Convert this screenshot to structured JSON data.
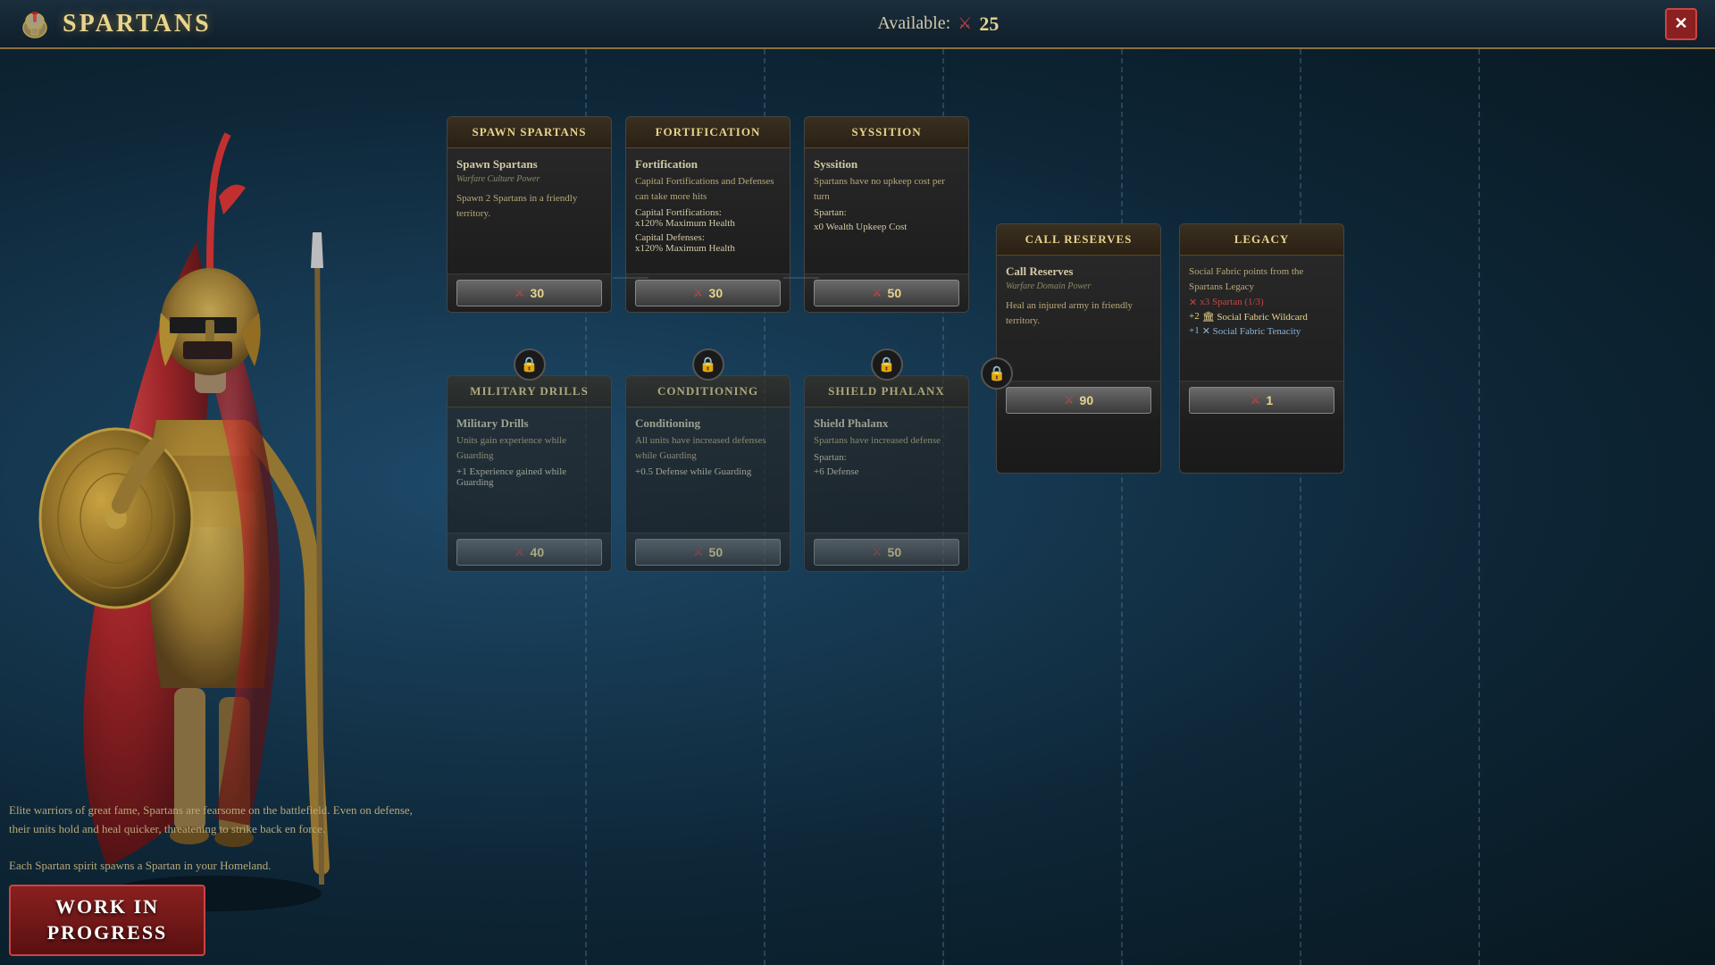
{
  "header": {
    "title": "Spartans",
    "icon": "⛨",
    "available_label": "Available:",
    "available_count": "25",
    "close_label": "✕"
  },
  "warrior": {
    "description": "Elite warriors of great fame, Spartans are fearsome on the battlefield. Even on defense, their units hold and heal quicker, threatening to strike back en force.",
    "description2": "Each Spartan spirit spawns a Spartan in your Homeland."
  },
  "wip": {
    "label": "Work In\nProgress"
  },
  "cards": [
    {
      "id": "spawn-spartans",
      "title": "Spawn Spartans",
      "name": "Spawn Spartans",
      "subtitle": "Warfare Culture Power",
      "description": "Spawn 2 Spartans in a friendly territory.",
      "stats": [],
      "cost": 30,
      "locked": false,
      "row": 0,
      "col": 0
    },
    {
      "id": "military-drills",
      "title": "Military Drills",
      "name": "Military Drills",
      "subtitle": "",
      "description": "Units gain experience while Guarding",
      "stats": [
        "+1 Experience gained while Guarding"
      ],
      "cost": 40,
      "locked": true,
      "row": 1,
      "col": 0
    },
    {
      "id": "fortification",
      "title": "Fortification",
      "name": "Fortification",
      "subtitle": "",
      "description": "Capital Fortifications and Defenses can take more hits",
      "stats": [
        "Capital Fortifications: x120% Maximum Health",
        "Capital Defenses: x120% Maximum Health"
      ],
      "cost": 30,
      "locked": false,
      "row": 0,
      "col": 1
    },
    {
      "id": "conditioning",
      "title": "Conditioning",
      "name": "Conditioning",
      "subtitle": "",
      "description": "All units have increased defenses while Guarding",
      "stats": [
        "+0.5 Defense while Guarding"
      ],
      "cost": 50,
      "locked": true,
      "row": 1,
      "col": 1
    },
    {
      "id": "syssition",
      "title": "Syssition",
      "name": "Syssition",
      "subtitle": "",
      "description": "Spartans have no upkeep cost per turn",
      "stats": [
        "Spartan:",
        "x0 Wealth Upkeep Cost"
      ],
      "cost": 50,
      "locked": false,
      "row": 0,
      "col": 2
    },
    {
      "id": "shield-phalanx",
      "title": "Shield Phalanx",
      "name": "Shield Phalanx",
      "subtitle": "",
      "description": "Spartans have increased defense",
      "stats": [
        "Spartan:",
        "+6 Defense"
      ],
      "cost": 50,
      "locked": true,
      "row": 1,
      "col": 2
    }
  ],
  "call_reserves": {
    "title": "Call Reserves",
    "name": "Call Reserves",
    "subtitle": "Warfare Domain Power",
    "description": "Heal an injured army in friendly territory.",
    "cost": 90,
    "locked": false
  },
  "legacy": {
    "title": "Legacy",
    "name": "Legacy",
    "description": "Social Fabric points from the Spartans Legacy",
    "bonuses": [
      {
        "color": "red",
        "text": "x3 Spartan (1/3)"
      },
      {
        "color": "yellow",
        "text": "+2 🏛 Social Fabric Wildcard"
      },
      {
        "color": "blue",
        "text": "+1 ✕ Social Fabric Tenacity"
      }
    ],
    "cost": 1,
    "locked": false
  }
}
